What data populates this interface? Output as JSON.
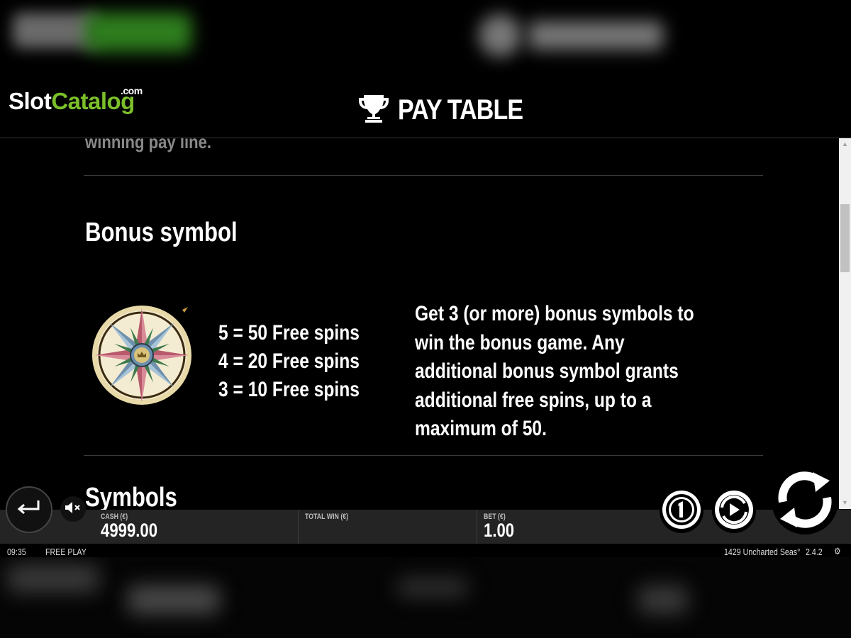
{
  "logo": {
    "slot": "Slot",
    "catalog": "Catalog",
    "com": ".com"
  },
  "header": {
    "title": "PAY TABLE",
    "icon": "trophy-icon"
  },
  "content": {
    "cut_off_text": "winning pay line.",
    "bonus_section": {
      "title": "Bonus symbol",
      "symbol_icon": "compass-rose-icon",
      "payouts": [
        "5 = 50 Free spins",
        "4 = 20 Free spins",
        "3 = 10 Free spins"
      ],
      "description_lines": [
        "Get 3 (or more) bonus symbols to",
        "win the bonus game. Any",
        "additional bonus symbol grants",
        "additional free spins, up to a",
        "maximum of 50."
      ]
    },
    "symbols_title": "Symbols"
  },
  "bar": {
    "cash_label": "CASH (€)",
    "cash_value": "4999.00",
    "total_win_label": "TOTAL WIN (€)",
    "total_win_value": "",
    "bet_label": "BET (€)",
    "bet_value": "1.00"
  },
  "status": {
    "time": "09:35",
    "mode": "FREE PLAY",
    "game": "1429 Uncharted Seas°",
    "version": "2.4.2"
  },
  "colors": {
    "brand_green": "#7bbf2a",
    "background": "#000000",
    "bar": "#242424"
  }
}
